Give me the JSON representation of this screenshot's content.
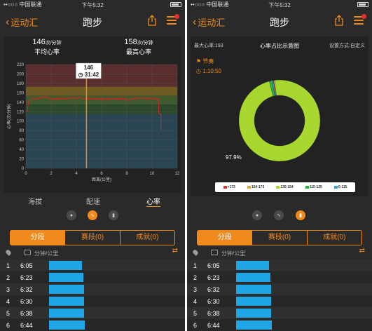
{
  "status": {
    "carrier": "••○○○ 中国联通",
    "time": "下午5:32"
  },
  "nav": {
    "back_label": "运动汇",
    "title": "跑步"
  },
  "left": {
    "avg_hr": {
      "value": "146",
      "unit": "次/分钟",
      "label": "平均心率"
    },
    "max_hr": {
      "value": "158",
      "unit": "次/分钟",
      "label": "最高心率"
    },
    "tooltip": {
      "value": "146",
      "time": "31:42"
    },
    "chart_data": {
      "type": "line",
      "title": "",
      "xlabel": "距离(公里)",
      "ylabel": "心率(次/分钟)",
      "xlim": [
        0,
        12
      ],
      "ylim": [
        0,
        220
      ],
      "x_ticks": [
        "0",
        "2",
        "4",
        "6",
        "8",
        "10",
        "12"
      ],
      "y_ticks": [
        "0",
        "20",
        "40",
        "60",
        "80",
        "100",
        "120",
        "140",
        "160",
        "180",
        "200",
        "220"
      ],
      "zones": [
        {
          "range": [
            173,
            220
          ],
          "color": "#5a2e2e"
        },
        {
          "range": [
            154,
            173
          ],
          "color": "#6f5c22"
        },
        {
          "range": [
            135,
            154
          ],
          "color": "#3f5a2d"
        },
        {
          "range": [
            115,
            135
          ],
          "color": "#2d4a2d"
        },
        {
          "range": [
            0,
            115
          ],
          "color": "#2a4654"
        }
      ],
      "series": [
        {
          "x": [
            0.1,
            0.2,
            0.5,
            1,
            1.5,
            2,
            3,
            4,
            5,
            6,
            7,
            8,
            9,
            10,
            10.5,
            10.55,
            10.7,
            10.7
          ],
          "y": [
            120,
            140,
            148,
            148,
            152,
            147,
            148,
            149,
            148,
            147,
            148,
            147,
            148,
            148,
            147,
            115,
            115,
            80
          ]
        }
      ],
      "cursor_x": 4.8
    },
    "tabs": [
      "海拔",
      "配速",
      "心率"
    ],
    "active_tab": "心率"
  },
  "right": {
    "max_hr_label": "最大心率:193",
    "pie_title": "心率占比示意图",
    "setting_label": "设置方式:自定义",
    "node_label": "节奏",
    "node_time": "1:10:50",
    "chart_data": {
      "type": "pie",
      "title": "心率占比示意图",
      "categories": [
        ">173",
        "154-173",
        "135-154",
        "115-135",
        "0-115"
      ],
      "values": [
        0.1,
        0.4,
        97.9,
        1.1,
        0.5
      ],
      "colors": [
        "#e83030",
        "#f0a030",
        "#a8d830",
        "#30b040",
        "#30a8d8"
      ],
      "center_label": "97.9%"
    }
  },
  "segment": [
    "分段",
    "赛段(0)",
    "成就(0)"
  ],
  "list_header": "分钟/公里",
  "rows": [
    {
      "n": "1",
      "pace": "6:05"
    },
    {
      "n": "2",
      "pace": "6:23"
    },
    {
      "n": "3",
      "pace": "6:32"
    },
    {
      "n": "4",
      "pace": "6:30"
    },
    {
      "n": "5",
      "pace": "6:38"
    },
    {
      "n": "6",
      "pace": "6:44"
    }
  ],
  "row_fraction": [
    0.87,
    0.91,
    0.92,
    0.92,
    0.93,
    0.95
  ]
}
